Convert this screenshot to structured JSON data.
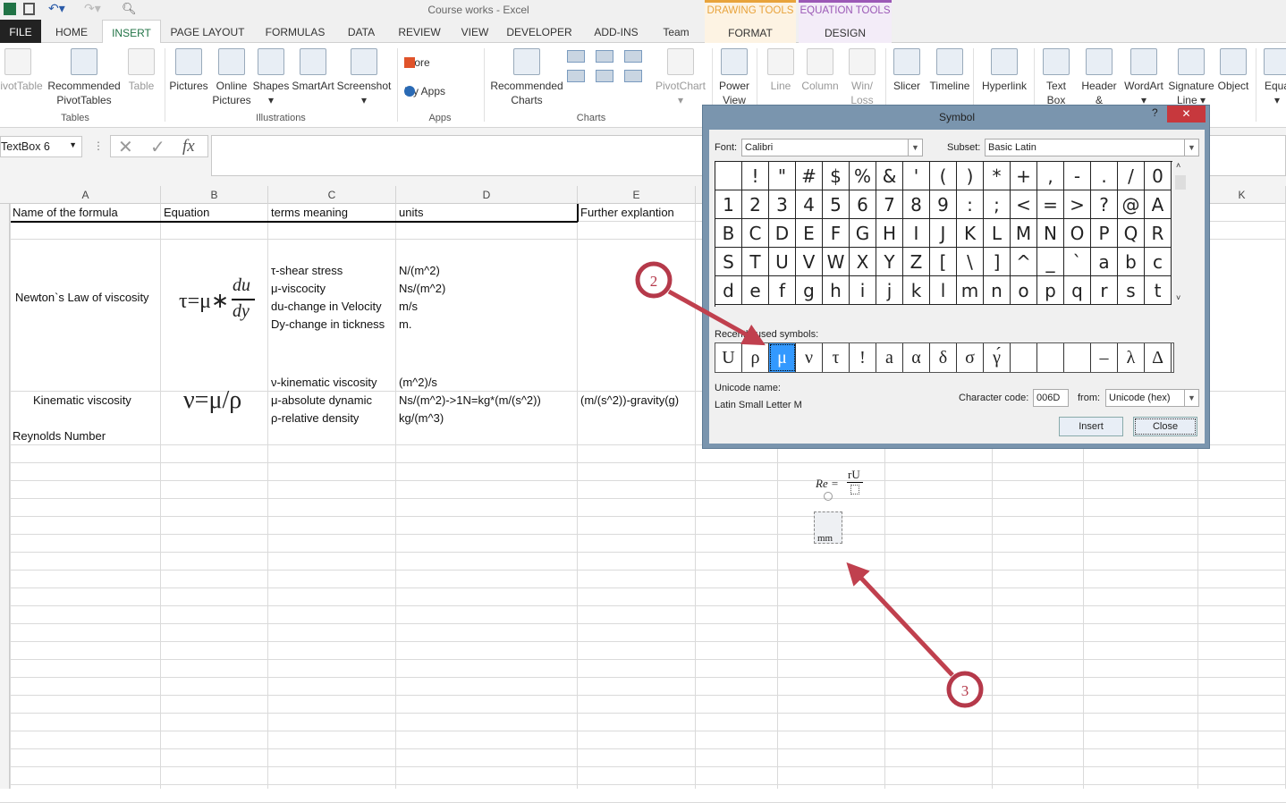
{
  "app": {
    "title": "Course works - Excel"
  },
  "tabs": [
    "FILE",
    "HOME",
    "INSERT",
    "PAGE LAYOUT",
    "FORMULAS",
    "DATA",
    "REVIEW",
    "VIEW",
    "DEVELOPER",
    "ADD-INS",
    "Team"
  ],
  "active_tab": "INSERT",
  "context_tabs": [
    {
      "group": "DRAWING TOOLS",
      "tab": "FORMAT",
      "color": "#e8a33b"
    },
    {
      "group": "EQUATION TOOLS",
      "tab": "DESIGN",
      "color": "#9b59b6"
    }
  ],
  "ribbon": {
    "buttons": [
      {
        "l1": "PivotTable",
        "l2": "",
        "dis": true
      },
      {
        "l1": "Recommended",
        "l2": "PivotTables"
      },
      {
        "l1": "Table",
        "l2": "",
        "dis": true
      },
      {
        "l1": "Pictures",
        "l2": ""
      },
      {
        "l1": "Online",
        "l2": "Pictures"
      },
      {
        "l1": "Shapes",
        "l2": "▾"
      },
      {
        "l1": "SmartArt",
        "l2": ""
      },
      {
        "l1": "Screenshot",
        "l2": "▾"
      },
      {
        "l1": "Recommended",
        "l2": "Charts"
      },
      {
        "l1": "PivotChart",
        "l2": "▾",
        "dis": true
      },
      {
        "l1": "Power",
        "l2": "View"
      },
      {
        "l1": "Line",
        "l2": "",
        "dis": true
      },
      {
        "l1": "Column",
        "l2": "",
        "dis": true
      },
      {
        "l1": "Win/",
        "l2": "Loss",
        "dis": true
      },
      {
        "l1": "Slicer",
        "l2": ""
      },
      {
        "l1": "Timeline",
        "l2": ""
      },
      {
        "l1": "Hyperlink",
        "l2": ""
      },
      {
        "l1": "Text",
        "l2": "Box"
      },
      {
        "l1": "Header",
        "l2": "& Footer"
      },
      {
        "l1": "WordArt",
        "l2": "▾"
      },
      {
        "l1": "Signature",
        "l2": "Line ▾"
      },
      {
        "l1": "Object",
        "l2": ""
      },
      {
        "l1": "Equa",
        "l2": "▾"
      }
    ],
    "store": "Store",
    "my_apps": "My Apps",
    "groups": [
      "Tables",
      "Illustrations",
      "Apps",
      "Charts"
    ]
  },
  "formula_bar": {
    "name_box": "TextBox 6",
    "fx": "fx",
    "value": ""
  },
  "columns": [
    "A",
    "B",
    "C",
    "D",
    "E",
    "F",
    "G",
    "H",
    "I",
    "J",
    "K"
  ],
  "sheet": {
    "headers": [
      "Name of the formula",
      "Equation",
      "terms meaning",
      "units",
      "Further explantion"
    ],
    "row2": {
      "name": "Newton`s Law of viscosity",
      "eq_left": "τ=μ∗",
      "eq_num": "du",
      "eq_den": "dy",
      "terms": [
        "τ-shear stress",
        "μ-viscocity",
        "du-change in Velocity",
        "Dy-change in tickness"
      ],
      "units": [
        "N/(m^2)",
        "Ns/(m^2)",
        "m/s",
        "m."
      ]
    },
    "row3": {
      "name": "Kinematic viscosity",
      "eq": "ν=μ/ρ",
      "terms": [
        "ν-kinematic viscosity",
        "μ-absolute dynamic",
        "ρ-relative density"
      ],
      "units": [
        "(m^2)/s",
        "Ns/(m^2)->1N=kg*(m/(s^2))",
        "kg/(m^3)"
      ],
      "further": "(m/(s^2))-gravity(g)"
    },
    "row4": {
      "name": "Reynolds Number"
    },
    "equation_object": {
      "lhs": "Re =",
      "num": "rU",
      "den_text": "mm"
    }
  },
  "symbol_dialog": {
    "title": "Symbol",
    "help": "?",
    "close": "✕",
    "font_label": "Font:",
    "font": "Calibri",
    "subset_label": "Subset:",
    "subset": "Basic Latin",
    "grid": [
      " ",
      "!",
      "\"",
      "#",
      "$",
      "%",
      "&",
      "'",
      "(",
      ")",
      "*",
      "+",
      ",",
      "-",
      ".",
      "/",
      "0",
      "1",
      "2",
      "3",
      "4",
      "5",
      "6",
      "7",
      "8",
      "9",
      ":",
      ";",
      "<",
      "=",
      ">",
      "?",
      "@",
      "A",
      "B",
      "C",
      "D",
      "E",
      "F",
      "G",
      "H",
      "I",
      "J",
      "K",
      "L",
      "M",
      "N",
      "O",
      "P",
      "Q",
      "R",
      "S",
      "T",
      "U",
      "V",
      "W",
      "X",
      "Y",
      "Z",
      "[",
      "\\",
      "]",
      "^",
      "_",
      "`",
      "a",
      "b",
      "c",
      "d",
      "e",
      "f",
      "g",
      "h",
      "i",
      "j",
      "k",
      "l",
      "m",
      "n",
      "o",
      "p",
      "q",
      "r",
      "s",
      "t"
    ],
    "recent_label": "Recently used symbols:",
    "recent": [
      "U",
      "ρ",
      "μ",
      "ν",
      "τ",
      "!",
      "a",
      "α",
      "δ",
      "σ",
      "γ́",
      "",
      "",
      "",
      "–",
      "λ",
      "Δ"
    ],
    "recent_selected": 2,
    "unicode_name_label": "Unicode name:",
    "unicode_name": "Latin Small Letter M",
    "char_code_label": "Character code:",
    "char_code": "006D",
    "from_label": "from:",
    "from": "Unicode (hex)",
    "insert": "Insert",
    "close_btn": "Close"
  },
  "annotations": [
    {
      "label": "2",
      "color": "#b5394a"
    },
    {
      "label": "3",
      "color": "#b5394a"
    }
  ]
}
